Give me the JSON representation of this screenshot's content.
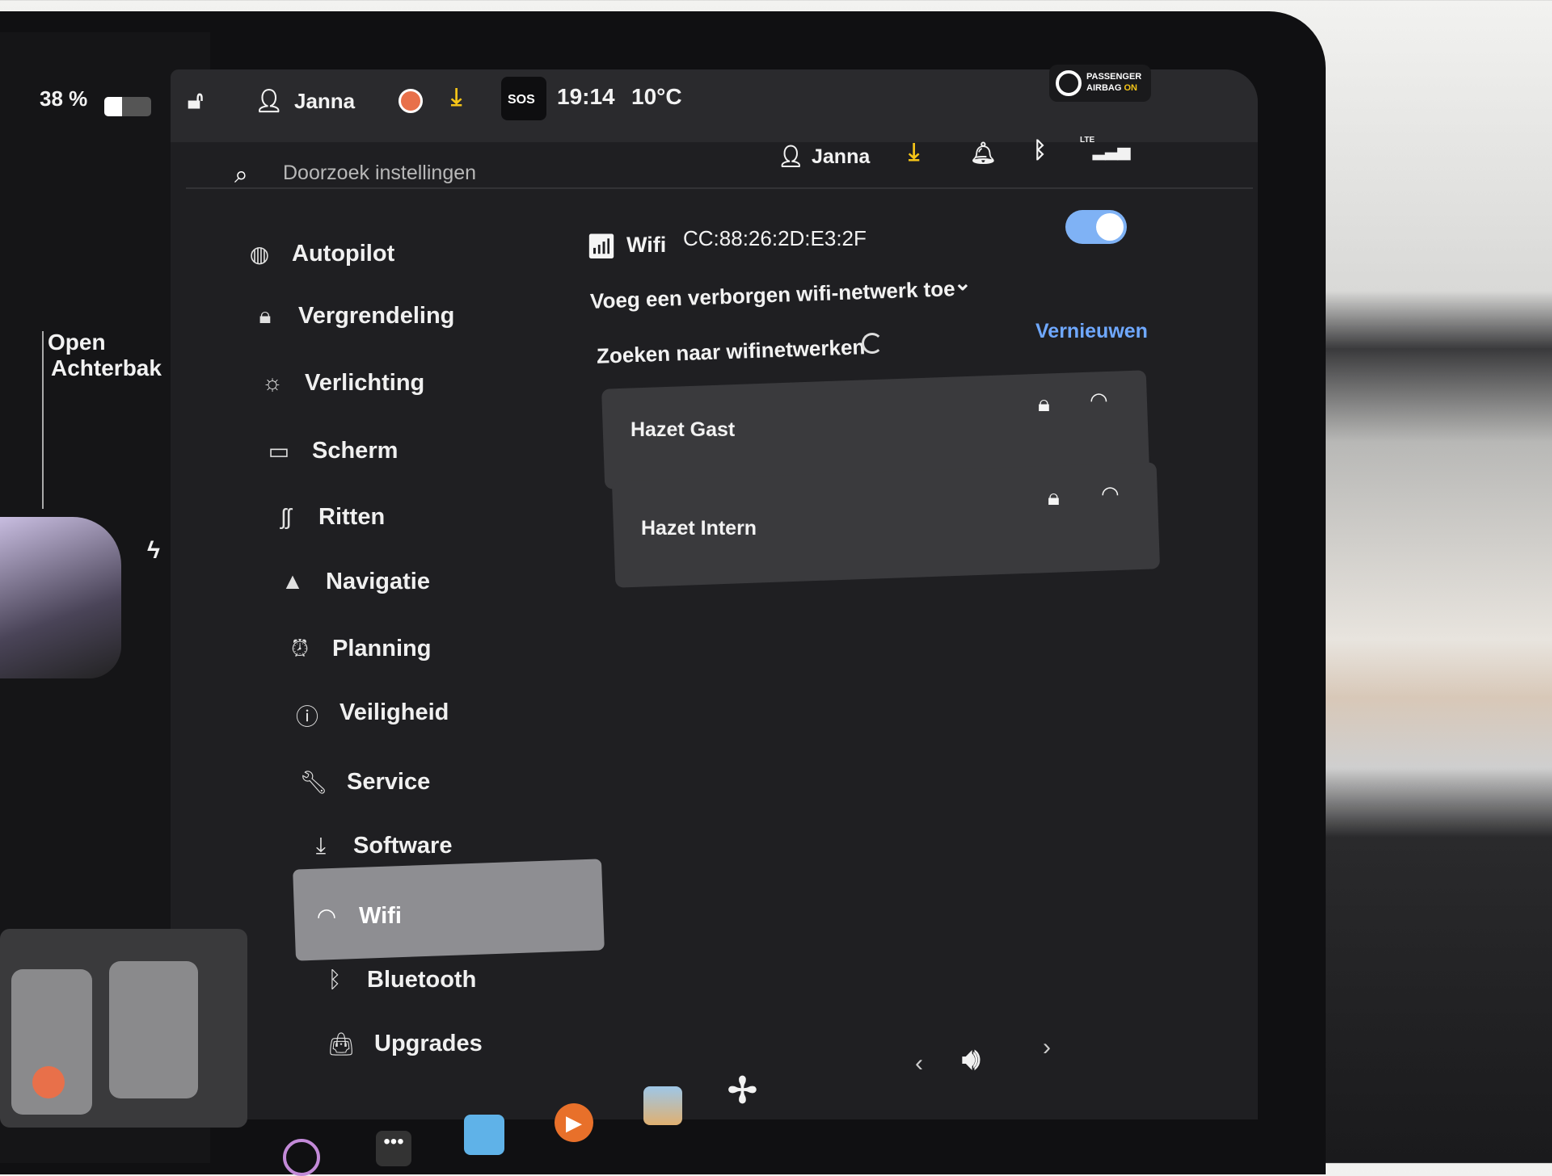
{
  "status_bar": {
    "battery": "38 %",
    "battery_level": 0.38,
    "driver": "Janna",
    "time": "19:14",
    "temperature": "10°C",
    "sos": "SOS",
    "airbag_line1": "PASSENGER",
    "airbag_line2": "AIRBAG",
    "airbag_state": "ON"
  },
  "left": {
    "trunk_label_1": "Open",
    "trunk_label_2": "Achterbak"
  },
  "search": {
    "placeholder": "Doorzoek instellingen"
  },
  "header": {
    "profile": "Janna",
    "network": "LTE"
  },
  "sidebar": {
    "items": [
      {
        "label": "Autopilot",
        "icon": "steering-wheel-icon"
      },
      {
        "label": "Vergrendeling",
        "icon": "lock-icon"
      },
      {
        "label": "Verlichting",
        "icon": "light-icon"
      },
      {
        "label": "Scherm",
        "icon": "display-icon"
      },
      {
        "label": "Ritten",
        "icon": "trips-icon"
      },
      {
        "label": "Navigatie",
        "icon": "navigation-icon"
      },
      {
        "label": "Planning",
        "icon": "alarm-icon"
      },
      {
        "label": "Veiligheid",
        "icon": "safety-icon"
      },
      {
        "label": "Service",
        "icon": "wrench-icon"
      },
      {
        "label": "Software",
        "icon": "download-icon"
      },
      {
        "label": "Wifi",
        "icon": "wifi-icon",
        "selected": true
      },
      {
        "label": "Bluetooth",
        "icon": "bluetooth-icon"
      },
      {
        "label": "Upgrades",
        "icon": "shopping-bag-icon"
      }
    ]
  },
  "wifi": {
    "title": "Wifi",
    "mac": "CC:88:26:2D:E3:2F",
    "enabled": true,
    "hidden_network": "Voeg een verborgen wifi-netwerk toe",
    "searching": "Zoeken naar wifinetwerken",
    "refresh": "Vernieuwen",
    "networks": [
      {
        "name": "Hazet Gast",
        "secured": true
      },
      {
        "name": "Hazet Intern",
        "secured": true
      }
    ]
  },
  "colors": {
    "accent": "#6fa8ff",
    "toggle": "#7fb2f5",
    "download": "#f5c518",
    "record": "#e8704a"
  }
}
